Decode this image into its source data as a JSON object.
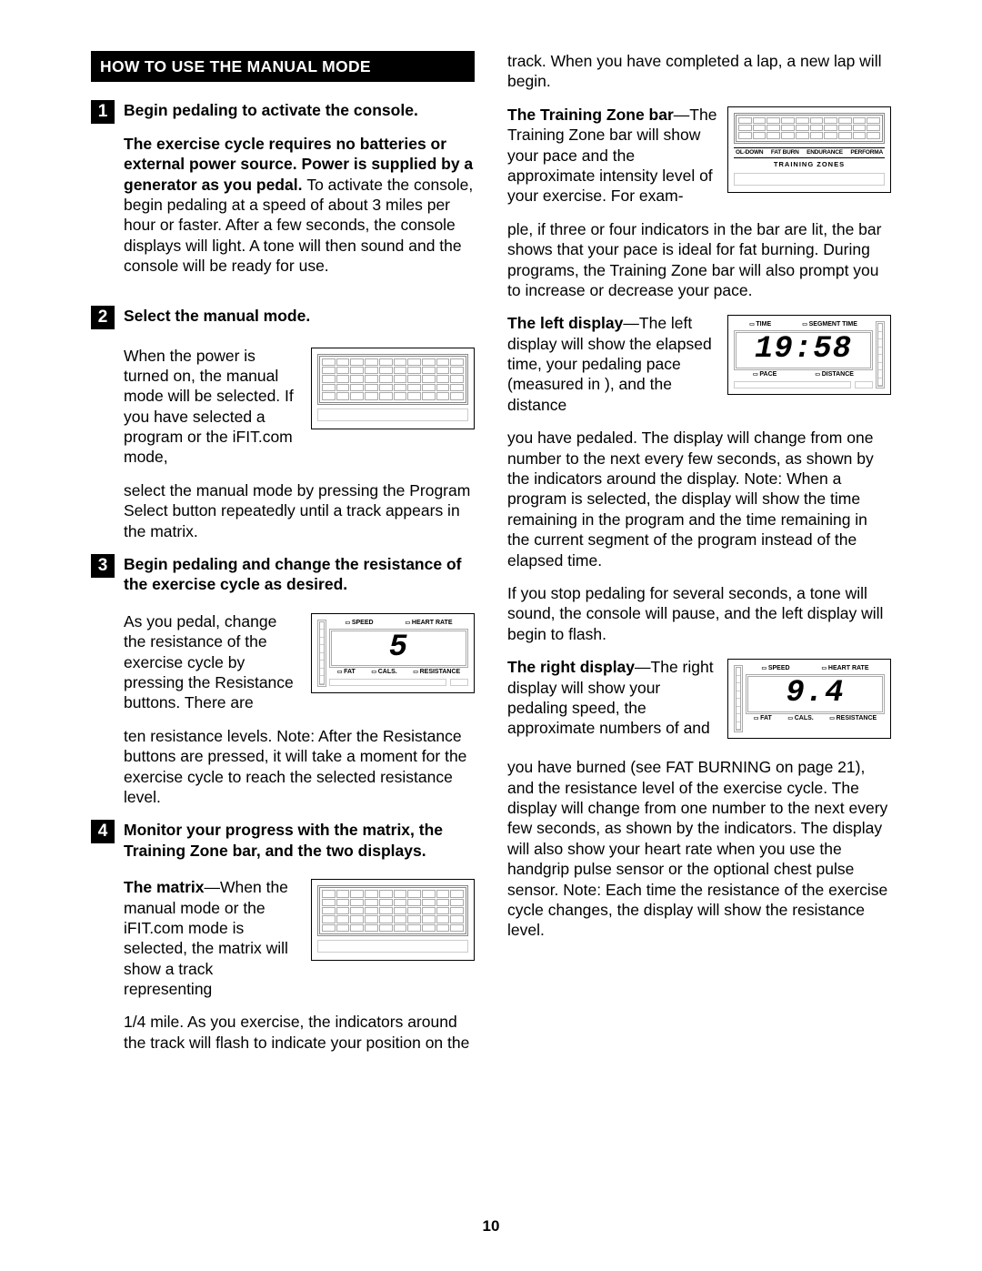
{
  "page_number": "10",
  "section_title": "HOW TO USE THE MANUAL MODE",
  "step1": {
    "num": "1",
    "heading": "Begin pedaling to activate the console.",
    "para1_bold": "The exercise cycle requires no batteries or external power source. Power is supplied by a generator as you pedal. ",
    "para1_rest": "To activate the console, begin pedaling at a speed of about 3 miles per hour or faster. After a few seconds, the console displays will light. A tone will then sound and the console will be ready for use."
  },
  "step2": {
    "num": "2",
    "heading": "Select the manual mode.",
    "para1": "When the power is turned on, the manual mode will be selected. If you have selected a program or the iFIT.com mode,",
    "para2": "select the manual mode by pressing the Program Select button repeatedly until a track appears in the matrix."
  },
  "step3": {
    "num": "3",
    "heading": "Begin pedaling and change the resistance of the exercise cycle as desired.",
    "para1": "As you pedal, change the resistance of the exercise cycle by pressing the Resistance buttons. There are",
    "para2": "ten resistance levels. Note: After the Resistance buttons are pressed, it will take a moment for the exercise cycle to reach the selected resistance level.",
    "fig_labels_top": [
      "SPEED",
      "HEART RATE"
    ],
    "fig_labels_bot": [
      "FAT",
      "CALS.",
      "RESISTANCE"
    ],
    "fig_value": "5"
  },
  "step4": {
    "num": "4",
    "heading": "Monitor your progress with the matrix, the Training Zone bar, and the two displays.",
    "matrix_bold": "The matrix",
    "matrix_text1": "—When the manual mode or the iFIT.com mode is selected, the matrix will show a track representing",
    "matrix_text2": "1/4 mile. As you exercise, the indicators around the track will flash to indicate your position on the"
  },
  "col2": {
    "top": "track. When you have completed a lap, a new lap will begin.",
    "tz_bold": "The Training Zone bar",
    "tz_text1": "—The Training Zone bar will show your pace and the approximate intensity level of your exercise. For exam-",
    "tz_text2": "ple, if three or four indicators in the bar are lit, the bar shows that your pace is ideal for fat burning. During programs, the Training Zone bar will also prompt you to increase or decrease your pace.",
    "tz_labels": [
      "OL-DOWN",
      "FAT BURN",
      "ENDURANCE",
      "PERFORMA"
    ],
    "tz_zones": "TRAINING ZONES",
    "left_bold": "The left display",
    "left_text1": "—The left display will show the elapsed time, your pedaling pace (measured in ), and the distance",
    "left_text2": "you have pedaled. The display will change from one number to the next every few seconds, as shown by the indicators around the display. Note: When a program is selected, the display will show the time remaining in the program and the time remaining in the current segment of the program instead of the elapsed time.",
    "left_labels_top": [
      "TIME",
      "SEGMENT TIME"
    ],
    "left_labels_bot": [
      "PACE",
      "DISTANCE"
    ],
    "left_value": "19:58",
    "pause": "If you stop pedaling for several seconds, a tone will sound, the console will pause, and the left display will begin to flash.",
    "right_bold": "The right display",
    "right_text1": "—The right display will show your pedaling speed, the approximate numbers of and",
    "right_text2": " you have burned (see FAT BURNING on page 21), and the resistance level of the exercise cycle. The display will change from one number to the next every few seconds, as shown by the indicators. The display will also show your heart rate when you use the handgrip pulse sensor or the optional chest pulse sensor. Note: Each time the resistance of the exercise cycle changes, the display will show the resistance level.",
    "right_labels_top": [
      "SPEED",
      "HEART RATE"
    ],
    "right_labels_bot": [
      "FAT",
      "CALS.",
      "RESISTANCE"
    ],
    "right_value": "9.4"
  }
}
